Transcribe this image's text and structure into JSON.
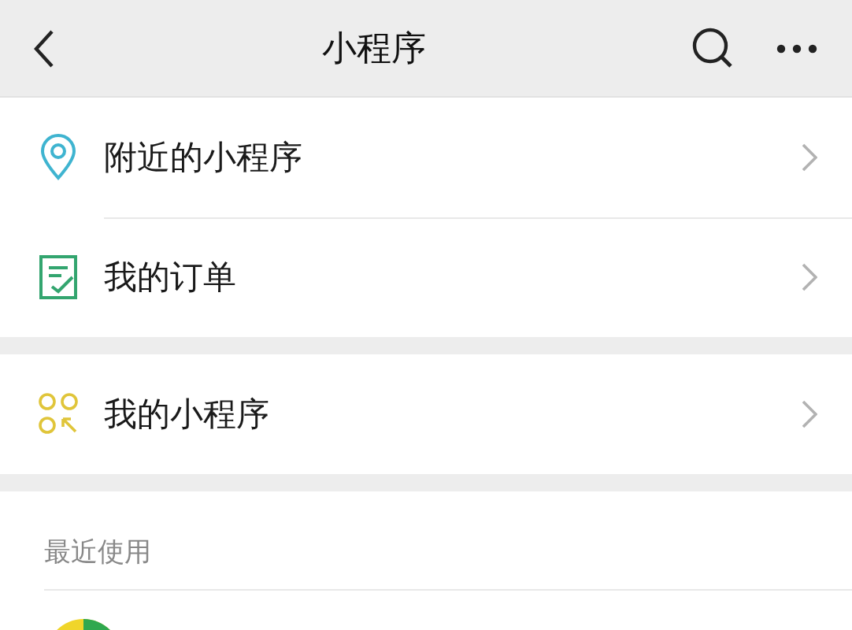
{
  "nav_bar": {
    "title": "小程序"
  },
  "groups": [
    {
      "items": [
        {
          "kind": "location",
          "label": "附近的小程序"
        },
        {
          "kind": "order",
          "label": "我的订单"
        }
      ]
    },
    {
      "items": [
        {
          "kind": "apps",
          "label": "我的小程序"
        }
      ]
    }
  ],
  "recent": {
    "header": "最近使用"
  }
}
